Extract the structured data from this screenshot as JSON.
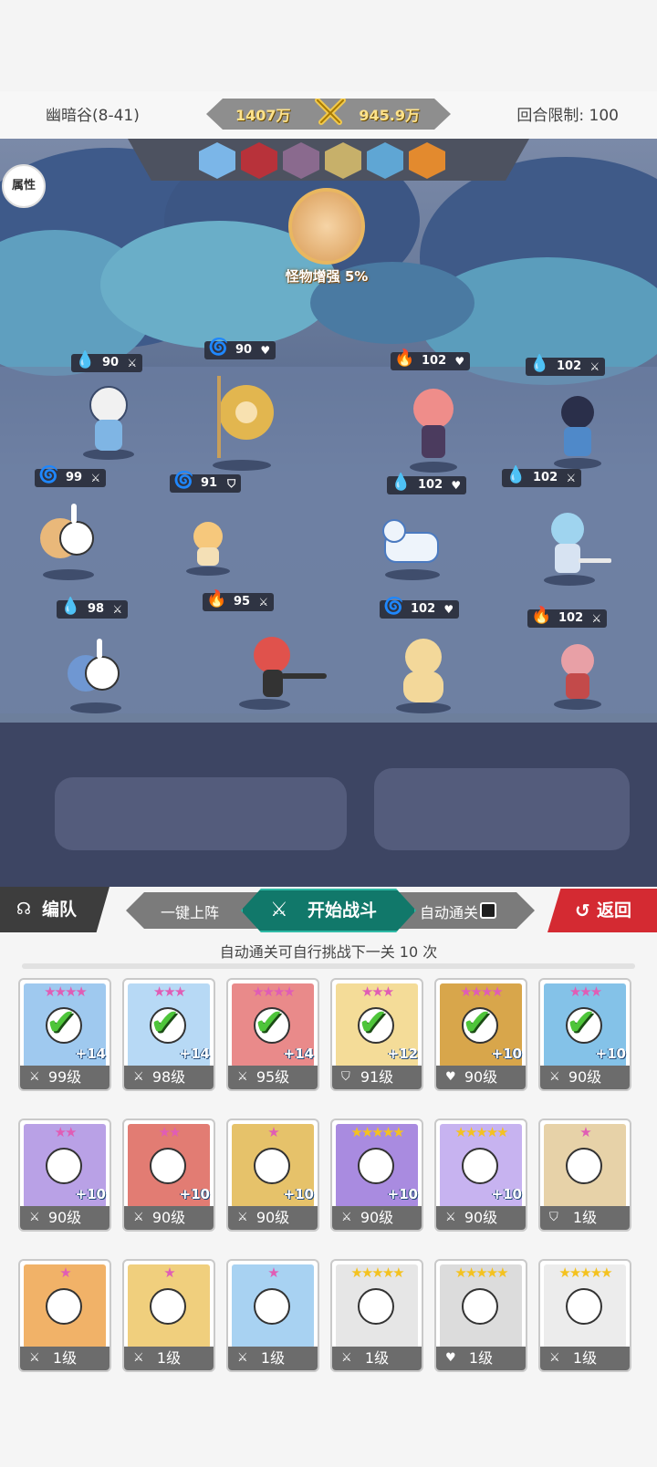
{
  "header": {
    "stage": "幽暗谷(8-41)",
    "my_power": "1407万",
    "enemy_power": "945.9万",
    "turn_limit": "回合限制: 100"
  },
  "battlefield": {
    "attribute_button": "属性",
    "boss_buff": "怪物增强 5%",
    "enemy_portraits": [
      "enemy-1",
      "enemy-2",
      "enemy-3",
      "enemy-4",
      "enemy-5",
      "enemy-6"
    ],
    "my_units": [
      {
        "level": "90",
        "element": "water",
        "role": "sword"
      },
      {
        "level": "99",
        "element": "wind",
        "role": "sword"
      },
      {
        "level": "98",
        "element": "water",
        "role": "sword"
      },
      {
        "level": "90",
        "element": "wind",
        "role": "heart"
      },
      {
        "level": "91",
        "element": "wind",
        "role": "shield"
      },
      {
        "level": "95",
        "element": "fire",
        "role": "sword"
      }
    ],
    "enemy_units": [
      {
        "level": "102",
        "element": "fire",
        "role": "heart"
      },
      {
        "level": "102",
        "element": "water",
        "role": "sword"
      },
      {
        "level": "102",
        "element": "water",
        "role": "heart"
      },
      {
        "level": "102",
        "element": "water",
        "role": "sword"
      },
      {
        "level": "102",
        "element": "wind",
        "role": "heart"
      },
      {
        "level": "102",
        "element": "fire",
        "role": "sword"
      }
    ]
  },
  "actions": {
    "team": "编队",
    "one_click": "一键上阵",
    "start_battle": "开始战斗",
    "auto_clear": "自动通关",
    "back": "返回"
  },
  "hint": "自动通关可自行挑战下一关 10 次",
  "roster": [
    {
      "level": "99级",
      "stars": "★★★★",
      "plus": "+14",
      "selected": true,
      "role": "sword",
      "color": "#9fc9ef"
    },
    {
      "level": "98级",
      "stars": "★★★",
      "plus": "+14",
      "selected": true,
      "role": "sword",
      "color": "#b7d9f5"
    },
    {
      "level": "95级",
      "stars": "★★★★",
      "plus": "+14",
      "selected": true,
      "role": "sword",
      "color": "#e98a8a"
    },
    {
      "level": "91级",
      "stars": "★★★",
      "plus": "+12",
      "selected": true,
      "role": "shield",
      "color": "#f4dc98"
    },
    {
      "level": "90级",
      "stars": "★★★★",
      "plus": "+10",
      "selected": true,
      "role": "heart",
      "color": "#d8a64b"
    },
    {
      "level": "90级",
      "stars": "★★★",
      "plus": "+10",
      "selected": true,
      "role": "sword",
      "color": "#84c2e8"
    },
    {
      "level": "90级",
      "stars": "★★",
      "plus": "+10",
      "selected": false,
      "role": "sword",
      "color": "#b9a1e6"
    },
    {
      "level": "90级",
      "stars": "★★",
      "plus": "+10",
      "selected": false,
      "role": "sword",
      "color": "#e27c73"
    },
    {
      "level": "90级",
      "stars": "★",
      "plus": "+10",
      "selected": false,
      "role": "sword",
      "color": "#e6c26a"
    },
    {
      "level": "90级",
      "stars": "★★★★★",
      "plus": "+10",
      "selected": false,
      "role": "sword",
      "color": "#a98be0"
    },
    {
      "level": "90级",
      "stars": "★★★★★",
      "plus": "+10",
      "selected": false,
      "role": "sword",
      "color": "#c7b3f0"
    },
    {
      "level": "1级",
      "stars": "★",
      "plus": "",
      "selected": false,
      "role": "shield",
      "color": "#e7d2a8"
    },
    {
      "level": "1级",
      "stars": "★",
      "plus": "",
      "selected": false,
      "role": "sword",
      "color": "#f1b268"
    },
    {
      "level": "1级",
      "stars": "★",
      "plus": "",
      "selected": false,
      "role": "sword",
      "color": "#f0cf7d"
    },
    {
      "level": "1级",
      "stars": "★",
      "plus": "",
      "selected": false,
      "role": "sword",
      "color": "#a8d2f2"
    },
    {
      "level": "1级",
      "stars": "★★★★★",
      "plus": "",
      "selected": false,
      "role": "sword",
      "color": "#e6e6e6"
    },
    {
      "level": "1级",
      "stars": "★★★★★",
      "plus": "",
      "selected": false,
      "role": "heart",
      "color": "#dcdcdc"
    },
    {
      "level": "1级",
      "stars": "★★★★★",
      "plus": "",
      "selected": false,
      "role": "sword",
      "color": "#ececec"
    }
  ],
  "colors": {
    "accent": "#11786a",
    "back": "#d42a32",
    "check": "#4ec53a"
  }
}
